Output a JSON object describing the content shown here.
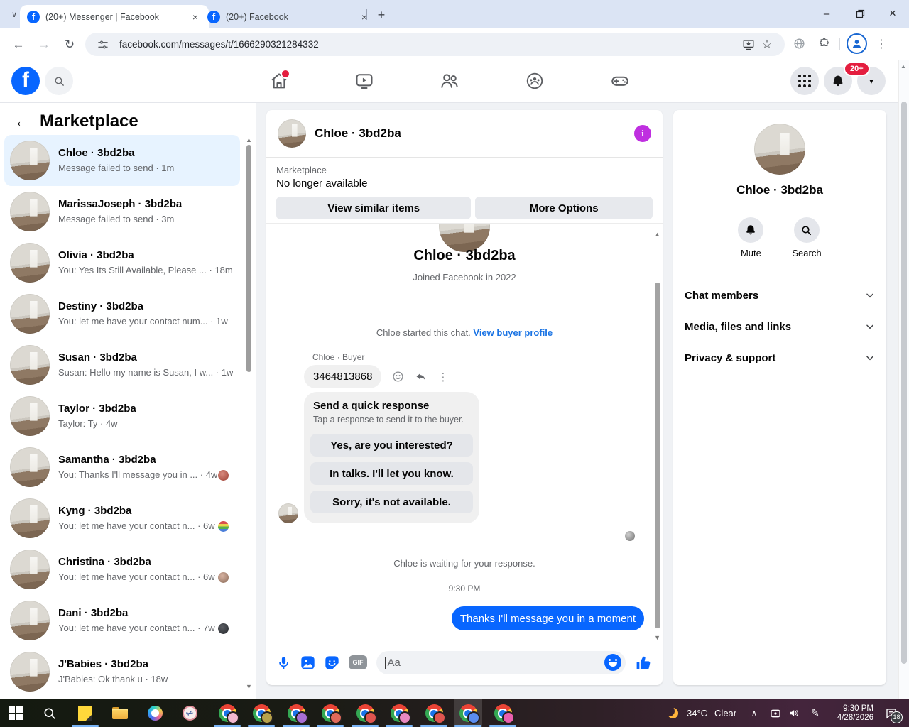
{
  "colors": {
    "fb_blue": "#0866ff",
    "bubble_blue": "#0866ff",
    "link_blue": "#1b74e4",
    "selected_row": "#e7f3ff",
    "info_purple": "#bf2fe0",
    "badge_red": "#e41e3f"
  },
  "icons": {
    "tab_search_chevron": "∨",
    "tab_close": "×",
    "new_tab": "+",
    "back": "←",
    "forward": "→",
    "reload": "↻",
    "star": "☆",
    "kebab": "⋮",
    "minimize": "–",
    "close_window": "×",
    "caret_down": "▾",
    "arrow_up_small": "▲",
    "arrow_down_small": "▼",
    "sidebar_back": "←",
    "scissors": "✂",
    "pen": "✎",
    "chevron_up": "∧",
    "dots_vertical": "⋮",
    "info": "i",
    "fb_f": "f"
  },
  "browser": {
    "tabs": [
      {
        "title": "(20+) Messenger | Facebook"
      },
      {
        "title": "(20+) Facebook"
      }
    ],
    "url": "facebook.com/messages/t/1666290321284332"
  },
  "fb_header": {
    "notification_badge": "20+"
  },
  "sidebar": {
    "title": "Marketplace",
    "conversations": [
      {
        "name": "Chloe · 3bd2ba",
        "snippet": "Message failed to send",
        "time": "· 1m"
      },
      {
        "name": "MarissaJoseph · 3bd2ba",
        "snippet": "Message failed to send",
        "time": "· 3m"
      },
      {
        "name": "Olivia · 3bd2ba",
        "snippet": "You: Yes Its Still Available, Please ...",
        "time": "· 18m"
      },
      {
        "name": "Destiny · 3bd2ba",
        "snippet": "You: let me have your contact num...",
        "time": "· 1w"
      },
      {
        "name": "Susan · 3bd2ba",
        "snippet": "Susan: Hello my name is Susan, I w...",
        "time": "· 1w"
      },
      {
        "name": "Taylor · 3bd2ba",
        "snippet": "Taylor: Ty",
        "time": "· 4w"
      },
      {
        "name": "Samantha · 3bd2ba",
        "snippet": "You: Thanks I'll message you in ...",
        "time": "· 4w",
        "indicator_color": "radial-gradient(circle at 40% 35%,#d98a7e,#9c3f33)"
      },
      {
        "name": "Kyng · 3bd2ba",
        "snippet": "You: let me have your contact n...",
        "time": "· 6w",
        "indicator_color": "linear-gradient(180deg,#d94f4f 25%,#e8d44d 25% 50%,#58b14c 50% 75%,#4c7fd9 75%)"
      },
      {
        "name": "Christina · 3bd2ba",
        "snippet": "You: let me have your contact n...",
        "time": "· 6w",
        "indicator_color": "radial-gradient(circle at 40% 35%,#d7b3a2,#8a6a58)"
      },
      {
        "name": "Dani · 3bd2ba",
        "snippet": "You: let me have your contact n...",
        "time": "· 7w",
        "indicator_color": "radial-gradient(circle at 40% 35%,#5a5d63,#25272b)"
      },
      {
        "name": "J'Babies · 3bd2ba",
        "snippet": "J'Babies: Ok thank u",
        "time": "· 18w"
      }
    ]
  },
  "chat": {
    "header_name": "Chloe · 3bd2ba",
    "banner": {
      "label": "Marketplace",
      "status": "No longer available",
      "view_similar_label": "View similar items",
      "more_options_label": "More Options"
    },
    "intro": {
      "name": "Chloe · 3bd2ba",
      "joined": "Joined Facebook in 2022"
    },
    "system_text": "Chloe started this chat. ",
    "system_link": "View buyer profile",
    "sender_label": "Chloe · Buyer",
    "message": "3464813868",
    "quick": {
      "title": "Send a quick response",
      "subtitle": "Tap a response to send it to the buyer.",
      "options": [
        "Yes, are you interested?",
        "In talks. I'll let you know.",
        "Sorry, it's not available."
      ]
    },
    "seen_indicator_color": "radial-gradient(circle at 35% 35%,#cfcfcf,#6f6f6f)",
    "waiting": "Chloe is waiting for your response.",
    "timestamp": "9:30 PM",
    "sent_message": "Thanks I'll message you in a moment",
    "composer_placeholder": "Aa",
    "gif_label": "GIF"
  },
  "details": {
    "name": "Chloe · 3bd2ba",
    "mute_label": "Mute",
    "search_label": "Search",
    "sections": [
      "Chat members",
      "Media, files and links",
      "Privacy & support"
    ]
  },
  "taskbar": {
    "weather_temp": "34°C",
    "weather_desc": "Clear",
    "clock_time": "9:30 PM",
    "clock_date": "4/28/2026",
    "notif_count": "18",
    "chrome_profiles": [
      "#f2b8d0",
      "#b8a24a",
      "#a86ed4",
      "#e06a5a",
      "#e0554f",
      "#e888c0",
      "#e0554f",
      "#5b8def",
      "#ea5fae"
    ]
  }
}
